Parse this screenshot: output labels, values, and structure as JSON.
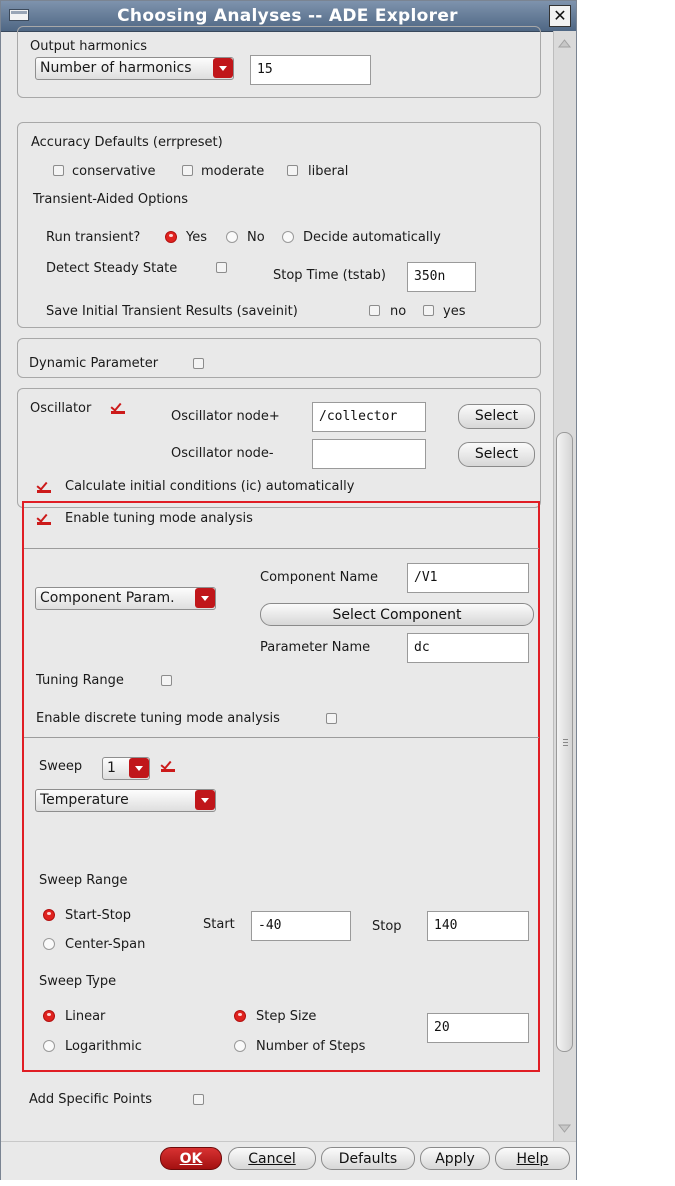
{
  "window": {
    "title": "Choosing Analyses -- ADE Explorer",
    "close_glyph": "✕"
  },
  "harmonics": {
    "label": "Output harmonics",
    "mode": "Number of harmonics",
    "value": "15"
  },
  "accuracy": {
    "label": "Accuracy Defaults (errpreset)",
    "options": [
      "conservative",
      "moderate",
      "liberal"
    ],
    "transient_aided": "Transient-Aided Options",
    "run_transient_label": "Run transient?",
    "run_transient_options": [
      "Yes",
      "No",
      "Decide automatically"
    ],
    "run_transient_selected": "Yes",
    "detect_steady_label": "Detect Steady State",
    "stop_time_label": "Stop Time (tstab)",
    "stop_time_value": "350n",
    "save_initial_label": "Save Initial Transient Results (saveinit)",
    "save_initial_options": [
      "no",
      "yes"
    ]
  },
  "dynamic": {
    "label": "Dynamic Parameter"
  },
  "oscillator": {
    "label": "Oscillator",
    "checked": true,
    "node_plus_label": "Oscillator node+",
    "node_plus_value": "/collector",
    "node_minus_label": "Oscillator node-",
    "node_minus_value": "",
    "select_label": "Select",
    "calc_ic_label": "Calculate initial conditions (ic) automatically",
    "tuning_label": "Enable tuning mode analysis"
  },
  "tuning": {
    "param_type": "Component Param.",
    "component_name_label": "Component Name",
    "component_name_value": "/V1",
    "select_component_label": "Select Component",
    "parameter_name_label": "Parameter Name",
    "parameter_name_value": "dc",
    "tuning_range_label": "Tuning Range",
    "discrete_label": "Enable discrete tuning mode analysis"
  },
  "sweep": {
    "label": "Sweep",
    "count": "1",
    "variable": "Temperature",
    "range_label": "Sweep Range",
    "range_options": [
      "Start-Stop",
      "Center-Span"
    ],
    "range_selected": "Start-Stop",
    "start_label": "Start",
    "start_value": "-40",
    "stop_label": "Stop",
    "stop_value": "140",
    "type_label": "Sweep Type",
    "type_options": [
      "Linear",
      "Logarithmic"
    ],
    "type_selected": "Linear",
    "step_options": [
      "Step Size",
      "Number of Steps"
    ],
    "step_selected": "Step Size",
    "step_value": "20"
  },
  "specific_points": {
    "label": "Add Specific Points"
  },
  "buttons": {
    "ok": "OK",
    "cancel": "Cancel",
    "defaults": "Defaults",
    "apply": "Apply",
    "help": "Help"
  },
  "colors": {
    "accent_red": "#e01d24",
    "title_bar": "#5f7593",
    "ok_button": "#b71b1b"
  }
}
